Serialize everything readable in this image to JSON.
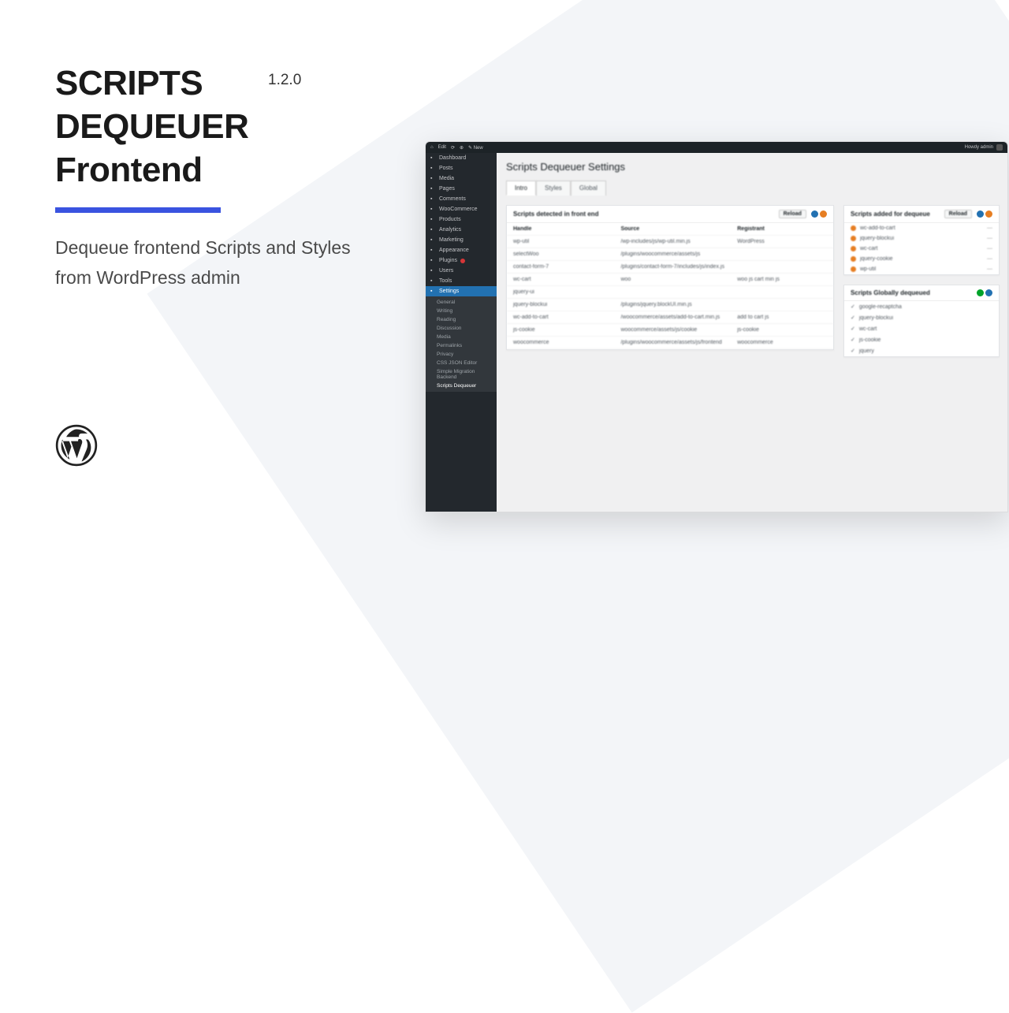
{
  "hero": {
    "title_line1": "SCRIPTS",
    "title_line2": "DEQUEUER",
    "title_line3": "Frontend",
    "version": "1.2.0",
    "subtitle": "Dequeue frontend Scripts and Styles from WordPress admin"
  },
  "adminbar": {
    "items": [
      "⌂",
      "Edit",
      "⟳",
      "⊕",
      "✎ New"
    ],
    "user": "Howdy admin"
  },
  "sidebar": {
    "items": [
      {
        "label": "Dashboard",
        "icon": "dashboard"
      },
      {
        "label": "Posts",
        "icon": "pin"
      },
      {
        "label": "Media",
        "icon": "media"
      },
      {
        "label": "Pages",
        "icon": "page"
      },
      {
        "label": "Comments",
        "icon": "chat"
      },
      {
        "label": "WooCommerce",
        "icon": "woo"
      },
      {
        "label": "Products",
        "icon": "box"
      },
      {
        "label": "Analytics",
        "icon": "chart"
      },
      {
        "label": "Marketing",
        "icon": "mega"
      },
      {
        "label": "Appearance",
        "icon": "brush"
      },
      {
        "label": "Plugins",
        "icon": "plug",
        "badge": true
      },
      {
        "label": "Users",
        "icon": "user"
      },
      {
        "label": "Tools",
        "icon": "tool"
      },
      {
        "label": "Settings",
        "icon": "gear",
        "active": true
      }
    ],
    "sub": [
      "General",
      "Writing",
      "Reading",
      "Discussion",
      "Media",
      "Permalinks",
      "Privacy",
      "CSS JSON Editor",
      "Simple Migration Backend",
      "Scripts Dequeuer"
    ]
  },
  "main": {
    "title": "Scripts Dequeuer Settings",
    "tabs": [
      "Intro",
      "Styles",
      "Global"
    ],
    "table_title": "Scripts detected in front end",
    "reload_btn": "Reload",
    "cols": [
      "Handle",
      "Source",
      "Registrant"
    ],
    "rows": [
      {
        "handle": "wp-util",
        "src": "/wp-includes/js/wp-util.min.js",
        "reg": "WordPress"
      },
      {
        "handle": "selectWoo",
        "src": "/plugins/woocommerce/assets/js",
        "reg": ""
      },
      {
        "handle": "contact-form-7",
        "src": "/plugins/contact-form-7/includes/js/index.js",
        "reg": ""
      },
      {
        "handle": "wc-cart",
        "src": "woo",
        "reg": "woo js cart min js"
      },
      {
        "handle": "jquery-ui",
        "src": "",
        "reg": ""
      },
      {
        "handle": "jquery-blockui",
        "src": "/plugins/jquery.blockUI.min.js",
        "reg": ""
      },
      {
        "handle": "wc-add-to-cart",
        "src": "/woocommerce/assets/add-to-cart.min.js",
        "reg": "add to cart js"
      },
      {
        "handle": "js-cookie",
        "src": "woocommerce/assets/js/cookie",
        "reg": "js-cookie"
      },
      {
        "handle": "woocommerce",
        "src": "/plugins/woocommerce/assets/js/frontend",
        "reg": "woocommerce"
      }
    ],
    "dequeue_title": "Scripts added for dequeue",
    "dequeue_items": [
      "wc-add-to-cart",
      "jquery-blockui",
      "wc-cart",
      "jquery-cookie",
      "wp-util"
    ],
    "global_title": "Scripts Globally dequeued",
    "global_items": [
      "google-recaptcha",
      "jquery-blockui",
      "wc-cart",
      "js-cookie",
      "jquery"
    ]
  }
}
